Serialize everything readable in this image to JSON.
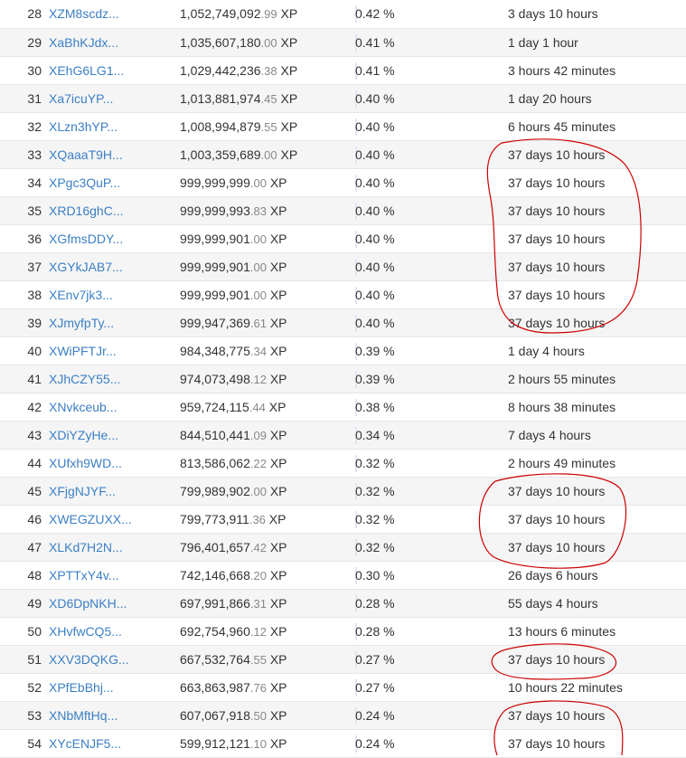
{
  "rows": [
    {
      "rank": "28",
      "address": "XZM8scdz...",
      "xp_int": "1,052,749,092",
      "xp_dec": ".99",
      "xp_unit": " XP",
      "percent": "0.42 %",
      "time": "3 days 10 hours"
    },
    {
      "rank": "29",
      "address": "XaBhKJdx...",
      "xp_int": "1,035,607,180",
      "xp_dec": ".00",
      "xp_unit": " XP",
      "percent": "0.41 %",
      "time": "1 day 1 hour"
    },
    {
      "rank": "30",
      "address": "XEhG6LG1...",
      "xp_int": "1,029,442,236",
      "xp_dec": ".38",
      "xp_unit": " XP",
      "percent": "0.41 %",
      "time": "3 hours 42 minutes"
    },
    {
      "rank": "31",
      "address": "Xa7icuYP...",
      "xp_int": "1,013,881,974",
      "xp_dec": ".45",
      "xp_unit": " XP",
      "percent": "0.40 %",
      "time": "1 day 20 hours"
    },
    {
      "rank": "32",
      "address": "XLzn3hYP...",
      "xp_int": "1,008,994,879",
      "xp_dec": ".55",
      "xp_unit": " XP",
      "percent": "0.40 %",
      "time": "6 hours 45 minutes"
    },
    {
      "rank": "33",
      "address": "XQaaaT9H...",
      "xp_int": "1,003,359,689",
      "xp_dec": ".00",
      "xp_unit": " XP",
      "percent": "0.40 %",
      "time": "37 days 10 hours"
    },
    {
      "rank": "34",
      "address": "XPgc3QuP...",
      "xp_int": "999,999,999",
      "xp_dec": ".00",
      "xp_unit": " XP",
      "percent": "0.40 %",
      "time": "37 days 10 hours"
    },
    {
      "rank": "35",
      "address": "XRD16ghC...",
      "xp_int": "999,999,993",
      "xp_dec": ".83",
      "xp_unit": " XP",
      "percent": "0.40 %",
      "time": "37 days 10 hours"
    },
    {
      "rank": "36",
      "address": "XGfmsDDY...",
      "xp_int": "999,999,901",
      "xp_dec": ".00",
      "xp_unit": " XP",
      "percent": "0.40 %",
      "time": "37 days 10 hours"
    },
    {
      "rank": "37",
      "address": "XGYkJAB7...",
      "xp_int": "999,999,901",
      "xp_dec": ".00",
      "xp_unit": " XP",
      "percent": "0.40 %",
      "time": "37 days 10 hours"
    },
    {
      "rank": "38",
      "address": "XEnv7jk3...",
      "xp_int": "999,999,901",
      "xp_dec": ".00",
      "xp_unit": " XP",
      "percent": "0.40 %",
      "time": "37 days 10 hours"
    },
    {
      "rank": "39",
      "address": "XJmyfpTy...",
      "xp_int": "999,947,369",
      "xp_dec": ".61",
      "xp_unit": " XP",
      "percent": "0.40 %",
      "time": "37 days 10 hours"
    },
    {
      "rank": "40",
      "address": "XWiPFTJr...",
      "xp_int": "984,348,775",
      "xp_dec": ".34",
      "xp_unit": " XP",
      "percent": "0.39 %",
      "time": "1 day 4 hours"
    },
    {
      "rank": "41",
      "address": "XJhCZY55...",
      "xp_int": "974,073,498",
      "xp_dec": ".12",
      "xp_unit": " XP",
      "percent": "0.39 %",
      "time": "2 hours 55 minutes"
    },
    {
      "rank": "42",
      "address": "XNvkceub...",
      "xp_int": "959,724,115",
      "xp_dec": ".44",
      "xp_unit": " XP",
      "percent": "0.38 %",
      "time": "8 hours 38 minutes"
    },
    {
      "rank": "43",
      "address": "XDiYZyHe...",
      "xp_int": "844,510,441",
      "xp_dec": ".09",
      "xp_unit": " XP",
      "percent": "0.34 %",
      "time": "7 days 4 hours"
    },
    {
      "rank": "44",
      "address": "XUfxh9WD...",
      "xp_int": "813,586,062",
      "xp_dec": ".22",
      "xp_unit": " XP",
      "percent": "0.32 %",
      "time": "2 hours 49 minutes"
    },
    {
      "rank": "45",
      "address": "XFjgNJYF...",
      "xp_int": "799,989,902",
      "xp_dec": ".00",
      "xp_unit": " XP",
      "percent": "0.32 %",
      "time": "37 days 10 hours"
    },
    {
      "rank": "46",
      "address": "XWEGZUXX...",
      "xp_int": "799,773,911",
      "xp_dec": ".36",
      "xp_unit": " XP",
      "percent": "0.32 %",
      "time": "37 days 10 hours"
    },
    {
      "rank": "47",
      "address": "XLKd7H2N...",
      "xp_int": "796,401,657",
      "xp_dec": ".42",
      "xp_unit": " XP",
      "percent": "0.32 %",
      "time": "37 days 10 hours"
    },
    {
      "rank": "48",
      "address": "XPTTxY4v...",
      "xp_int": "742,146,668",
      "xp_dec": ".20",
      "xp_unit": " XP",
      "percent": "0.30 %",
      "time": "26 days 6 hours"
    },
    {
      "rank": "49",
      "address": "XD6DpNKH...",
      "xp_int": "697,991,866",
      "xp_dec": ".31",
      "xp_unit": " XP",
      "percent": "0.28 %",
      "time": "55 days 4 hours"
    },
    {
      "rank": "50",
      "address": "XHvfwCQ5...",
      "xp_int": "692,754,960",
      "xp_dec": ".12",
      "xp_unit": " XP",
      "percent": "0.28 %",
      "time": "13 hours 6 minutes"
    },
    {
      "rank": "51",
      "address": "XXV3DQKG...",
      "xp_int": "667,532,764",
      "xp_dec": ".55",
      "xp_unit": " XP",
      "percent": "0.27 %",
      "time": "37 days 10 hours"
    },
    {
      "rank": "52",
      "address": "XPfEbBhj...",
      "xp_int": "663,863,987",
      "xp_dec": ".76",
      "xp_unit": " XP",
      "percent": "0.27 %",
      "time": "10 hours 22 minutes"
    },
    {
      "rank": "53",
      "address": "XNbMftHq...",
      "xp_int": "607,067,918",
      "xp_dec": ".50",
      "xp_unit": " XP",
      "percent": "0.24 %",
      "time": "37 days 10 hours"
    },
    {
      "rank": "54",
      "address": "XYcENJF5...",
      "xp_int": "599,912,121",
      "xp_dec": ".10",
      "xp_unit": " XP",
      "percent": "0.24 %",
      "time": "37 days 10 hours"
    }
  ],
  "colors": {
    "link": "#3b7fc4",
    "annotation": "#cc0000",
    "stripe": "#f5f5f5"
  }
}
